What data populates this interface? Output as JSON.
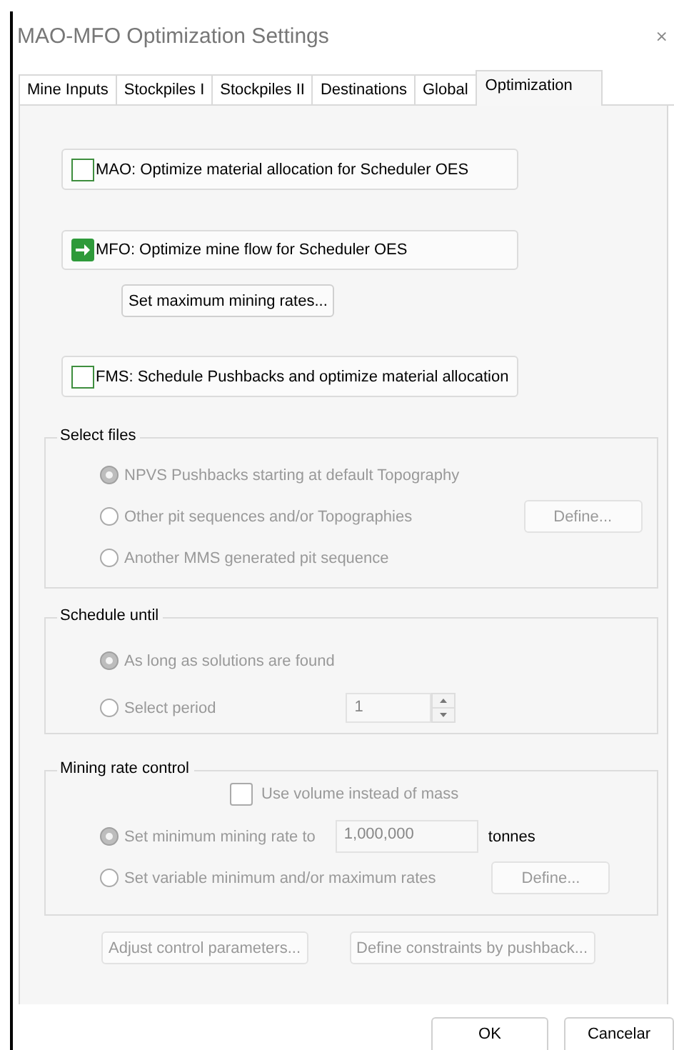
{
  "window": {
    "title": "MAO-MFO Optimization Settings",
    "close": "×"
  },
  "tabs": [
    {
      "label": "Mine Inputs",
      "selected": false
    },
    {
      "label": "Stockpiles I",
      "selected": false
    },
    {
      "label": "Stockpiles II",
      "selected": false
    },
    {
      "label": "Destinations",
      "selected": false
    },
    {
      "label": "Global",
      "selected": false
    },
    {
      "label": "Optimization",
      "selected": true
    }
  ],
  "options": [
    {
      "kind": "checkbox",
      "label": "MAO: Optimize material allocation for Scheduler OES",
      "checked": false
    },
    {
      "kind": "arrow",
      "label": "MFO: Optimize mine flow for Scheduler  OES",
      "sub_button": "Set maximum mining rates..."
    },
    {
      "kind": "checkbox",
      "label": "FMS: Schedule Pushbacks and optimize material allocation",
      "checked": false
    }
  ],
  "select_files": {
    "title": "Select files",
    "disabled": true,
    "define_button": "Define...",
    "radios": [
      {
        "label": "NPVS Pushbacks starting at default Topography",
        "selected": true
      },
      {
        "label": "Other pit sequences and/or Topographies",
        "selected": false
      },
      {
        "label": "Another MMS generated pit sequence",
        "selected": false
      }
    ]
  },
  "schedule_until": {
    "title": "Schedule until",
    "disabled": true,
    "radios": [
      {
        "label": "As long as solutions are found",
        "selected": true
      },
      {
        "label": "Select period",
        "selected": false
      }
    ],
    "period_value": "1"
  },
  "mining_rate_control": {
    "title": "Mining rate control",
    "disabled": true,
    "use_volume": {
      "label": "Use volume instead of mass",
      "checked": false
    },
    "radios": [
      {
        "label": "Set minimum mining rate to",
        "selected": true
      },
      {
        "label": "Set variable minimum and/or maximum rates",
        "selected": false
      }
    ],
    "rate_value": "1,000,000",
    "unit": "tonnes",
    "define_button": "Define..."
  },
  "lower_buttons": [
    {
      "label": "Adjust control parameters...",
      "disabled": true
    },
    {
      "label": "Define constraints by pushback...",
      "disabled": true
    }
  ],
  "buttons": [
    {
      "label": "OK"
    },
    {
      "label": "Cancelar"
    }
  ]
}
